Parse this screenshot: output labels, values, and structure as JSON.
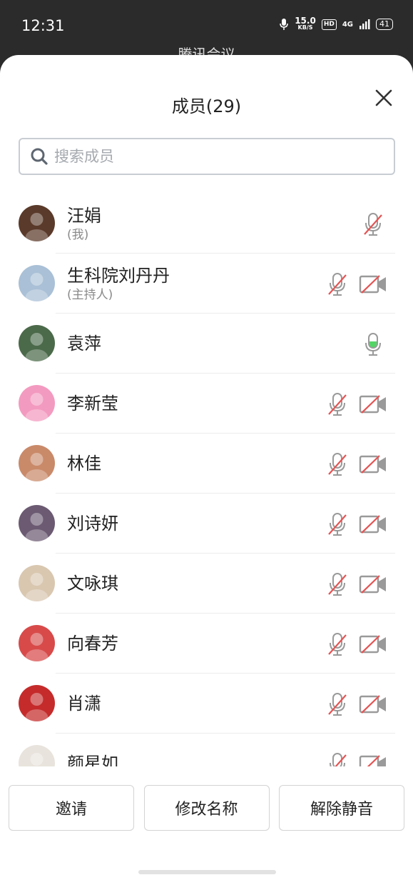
{
  "status_bar": {
    "time": "12:31",
    "speed_value": "15.0",
    "speed_unit": "KB/S",
    "hd": "HD",
    "network": "4G",
    "battery": "41"
  },
  "background_title": "腾讯会议",
  "sheet": {
    "title": "成员(29)"
  },
  "search": {
    "placeholder": "搜索成员",
    "value": ""
  },
  "colors": {
    "muted_red": "#e45454",
    "icon_gray": "#9a9a9a",
    "speaking_green": "#55d466"
  },
  "members": [
    {
      "name": "汪娟",
      "role": "(我)",
      "mic": "muted",
      "camera": "none",
      "avatar_color": "#5a3a2a"
    },
    {
      "name": "生科院刘丹丹",
      "role": "(主持人)",
      "mic": "muted",
      "camera": "off",
      "avatar_color": "#a9c0d6"
    },
    {
      "name": "袁萍",
      "role": "",
      "mic": "speaking",
      "camera": "none",
      "avatar_color": "#4b6a4a"
    },
    {
      "name": "李新莹",
      "role": "",
      "mic": "muted",
      "camera": "off",
      "avatar_color": "#f39ac0"
    },
    {
      "name": "林佳",
      "role": "",
      "mic": "muted",
      "camera": "off",
      "avatar_color": "#c98a6a"
    },
    {
      "name": "刘诗妍",
      "role": "",
      "mic": "muted",
      "camera": "off",
      "avatar_color": "#6b5a72"
    },
    {
      "name": "文咏琪",
      "role": "",
      "mic": "muted",
      "camera": "off",
      "avatar_color": "#d9c7b0"
    },
    {
      "name": "向春芳",
      "role": "",
      "mic": "muted",
      "camera": "off",
      "avatar_color": "#d84a4a"
    },
    {
      "name": "肖潇",
      "role": "",
      "mic": "muted",
      "camera": "off",
      "avatar_color": "#c52b2b"
    },
    {
      "name": "颜星如",
      "role": "",
      "mic": "muted",
      "camera": "off",
      "avatar_color": "#e8e3dc"
    }
  ],
  "buttons": {
    "invite": "邀请",
    "rename": "修改名称",
    "unmute": "解除静音"
  }
}
